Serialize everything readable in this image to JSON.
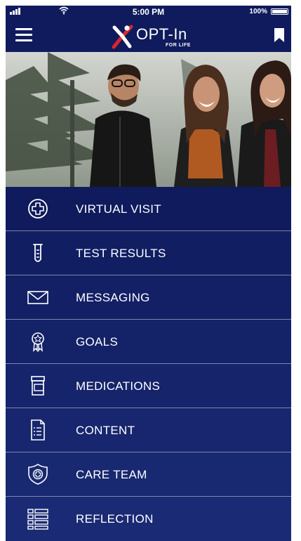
{
  "status_bar": {
    "time": "5:00 PM",
    "battery": "100%"
  },
  "header": {
    "logo_text": "OPT-In",
    "logo_subtext": "FOR LIFE",
    "menu_icon": "hamburger-menu-icon",
    "bookmark_icon": "bookmark-icon"
  },
  "hero": {
    "description_icon": "photo"
  },
  "menu": {
    "items": [
      {
        "label": "VIRTUAL VISIT",
        "icon": "plus-circle-icon"
      },
      {
        "label": "TEST RESULTS",
        "icon": "test-tube-icon"
      },
      {
        "label": "MESSAGING",
        "icon": "envelope-icon"
      },
      {
        "label": "GOALS",
        "icon": "award-ribbon-icon"
      },
      {
        "label": "MEDICATIONS",
        "icon": "pill-bottle-icon"
      },
      {
        "label": "CONTENT",
        "icon": "document-list-icon"
      },
      {
        "label": "CARE TEAM",
        "icon": "shield-plus-icon"
      },
      {
        "label": "REFLECTION",
        "icon": "list-icon"
      }
    ]
  },
  "colors": {
    "background": "#0f1b5c",
    "accent_red": "#d9262b",
    "text": "#ffffff"
  }
}
